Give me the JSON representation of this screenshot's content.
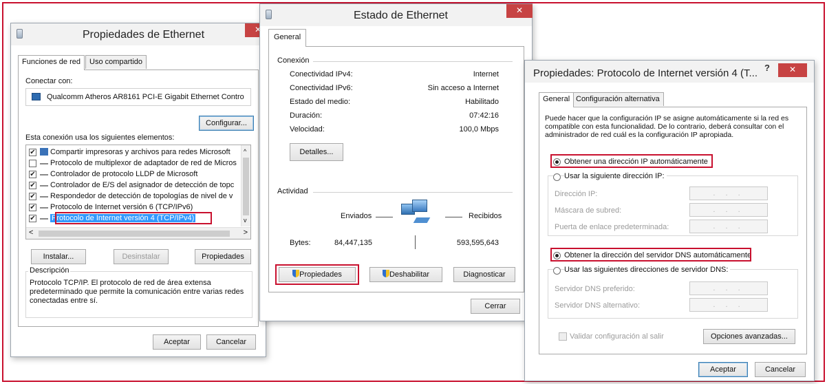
{
  "colors": {
    "highlight_red": "#c8102e",
    "selection_blue": "#3399ff",
    "close_red": "#c74343"
  },
  "eth_props": {
    "title": "Propiedades de Ethernet",
    "close": "✕",
    "tabs": [
      "Funciones de red",
      "Uso compartido"
    ],
    "connect_label": "Conectar con:",
    "adapter": "Qualcomm Atheros AR8161 PCI-E Gigabit Ethernet Contro",
    "configure": "Configurar...",
    "elements_label": "Esta conexión usa los siguientes elementos:",
    "items": [
      {
        "label": "Compartir impresoras y archivos para redes Microsoft",
        "checked": "☑"
      },
      {
        "label": "Protocolo de multiplexor de adaptador de red de Micros",
        "checked": ""
      },
      {
        "label": "Controlador de protocolo LLDP de Microsoft",
        "checked": "☑"
      },
      {
        "label": "Controlador de E/S del asignador de detección de topc",
        "checked": "☑"
      },
      {
        "label": "Respondedor de detección de topologías de nivel de v",
        "checked": "☑"
      },
      {
        "label": "Protocolo de Internet versión 6 (TCP/IPv6)",
        "checked": "☑"
      },
      {
        "label": "Protocolo de Internet versión 4 (TCP/IPv4)",
        "checked": "☑"
      }
    ],
    "check": "✔",
    "install": "Instalar...",
    "uninstall": "Desinstalar",
    "properties": "Propiedades",
    "description_label": "Descripción",
    "description": "Protocolo TCP/IP. El protocolo de red de área extensa predeterminado que permite la comunicación entre varias redes conectadas entre sí.",
    "ok": "Aceptar",
    "cancel": "Cancelar"
  },
  "eth_status": {
    "title": "Estado de Ethernet",
    "close": "✕",
    "tab": "General",
    "connection_label": "Conexión",
    "rows": [
      {
        "label": "Conectividad IPv4:",
        "value": "Internet"
      },
      {
        "label": "Conectividad IPv6:",
        "value": "Sin acceso a Internet"
      },
      {
        "label": "Estado del medio:",
        "value": "Habilitado"
      },
      {
        "label": "Duración:",
        "value": "07:42:16"
      },
      {
        "label": "Velocidad:",
        "value": "100,0 Mbps"
      }
    ],
    "details": "Detalles...",
    "activity_label": "Actividad",
    "sent": "Enviados",
    "received": "Recibidos",
    "bytes_label": "Bytes:",
    "bytes_sent": "84,447,135",
    "bytes_received": "593,595,643",
    "properties": "Propiedades",
    "disable": "Deshabilitar",
    "diagnose": "Diagnosticar",
    "close_button": "Cerrar"
  },
  "ipv4_props": {
    "title": "Propiedades: Protocolo de Internet versión 4 (T...",
    "help": "?",
    "close": "✕",
    "tabs": [
      "General",
      "Configuración alternativa"
    ],
    "intro": "Puede hacer que la configuración IP se asigne automáticamente si la red es compatible con esta funcionalidad. De lo contrario, deberá consultar con el administrador de red cuál es la configuración IP apropiada.",
    "auto_ip": "Obtener una dirección IP automáticamente",
    "manual_ip": "Usar la siguiente dirección IP:",
    "ip_address": "Dirección IP:",
    "subnet": "Máscara de subred:",
    "gateway": "Puerta de enlace predeterminada:",
    "auto_dns": "Obtener la dirección del servidor DNS automáticamente",
    "manual_dns": "Usar las siguientes direcciones de servidor DNS:",
    "preferred_dns": "Servidor DNS preferido:",
    "alternate_dns": "Servidor DNS alternativo:",
    "ip_placeholder": ". . .",
    "validate": "Validar configuración al salir",
    "advanced": "Opciones avanzadas...",
    "ok": "Aceptar",
    "cancel": "Cancelar"
  }
}
